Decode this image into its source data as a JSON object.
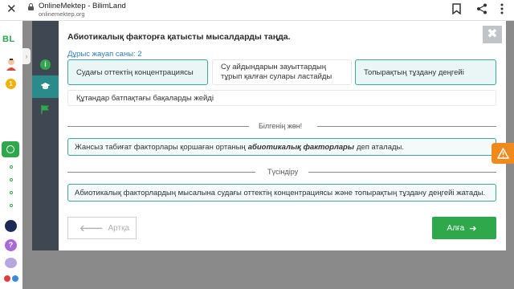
{
  "browser": {
    "title": "OnlineMektep - BilimLand",
    "url": "onlinemektep.org",
    "icons": [
      "close-icon",
      "lock-icon",
      "bookmark-icon",
      "share-icon",
      "more-icon"
    ]
  },
  "rail": {
    "logo": "BL",
    "coin_label": "1",
    "help_label": "?"
  },
  "panel": {
    "question": "Абиотикалық факторға қатысты мысалдарды таңда.",
    "close_label": "✖",
    "answers_count": "Дұрыс жауап саны: 2",
    "options": [
      {
        "label": "Судағы оттектің концентрациясы",
        "selected": true
      },
      {
        "label": "Су айдындарын зауыттардың тұрып қалған сулары ластайды",
        "selected": false
      },
      {
        "label": "Топырақтың тұздану деңгейі",
        "selected": true
      },
      {
        "label": "Құтандар батпақтағы бақаларды жейді",
        "selected": false
      }
    ],
    "know_heading": "Білгенің жөн!",
    "know_text_before": "Жансыз табиғат факторлары қоршаған ортаның",
    "know_text_em": "абиотикалық факторлары",
    "know_text_after": "деп аталады.",
    "explain_heading": "Түсіндіру",
    "explain_text": "Абиотикалық факторлардың мысалына судағы оттектің концентрациясы және топырақтың тұздану деңгейі жатады.",
    "back_label": "Артқа",
    "next_label": "Алға"
  },
  "colors": {
    "accent": "#2ea84a",
    "teal": "#3aa8a0",
    "sidebar": "#3e4752",
    "warning": "#f08a1c"
  }
}
